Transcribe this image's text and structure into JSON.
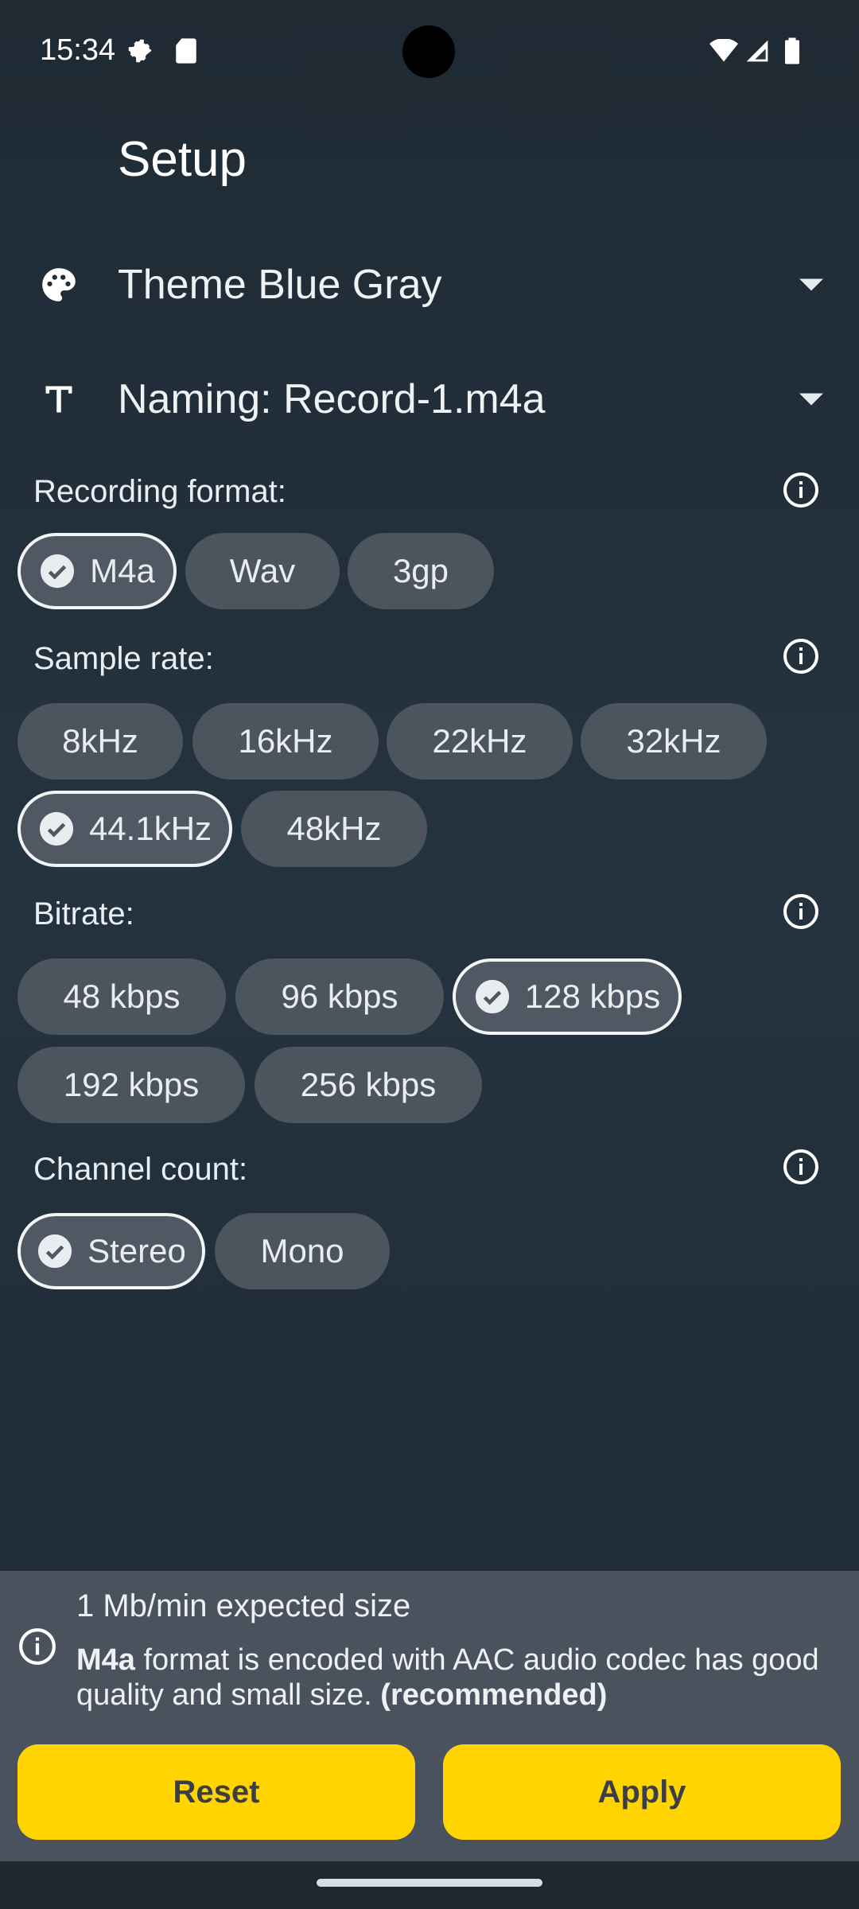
{
  "status_bar": {
    "time": "15:34",
    "icons": [
      "settings-gear-icon",
      "sd-card-icon",
      "wifi-icon",
      "signal-icon",
      "battery-icon"
    ]
  },
  "page": {
    "title": "Setup"
  },
  "theme_dropdown": {
    "label": "Theme Blue Gray",
    "icon": "palette-icon"
  },
  "naming_dropdown": {
    "label": "Naming: Record-1.m4a",
    "icon": "text-format-icon"
  },
  "recording_format": {
    "label": "Recording format:",
    "options": [
      {
        "label": "M4a",
        "selected": true
      },
      {
        "label": "Wav",
        "selected": false
      },
      {
        "label": "3gp",
        "selected": false
      }
    ]
  },
  "sample_rate": {
    "label": "Sample rate:",
    "options": [
      {
        "label": "8kHz",
        "selected": false
      },
      {
        "label": "16kHz",
        "selected": false
      },
      {
        "label": "22kHz",
        "selected": false
      },
      {
        "label": "32kHz",
        "selected": false
      },
      {
        "label": "44.1kHz",
        "selected": true
      },
      {
        "label": "48kHz",
        "selected": false
      }
    ]
  },
  "bitrate": {
    "label": "Bitrate:",
    "options": [
      {
        "label": "48 kbps",
        "selected": false
      },
      {
        "label": "96 kbps",
        "selected": false
      },
      {
        "label": "128 kbps",
        "selected": true
      },
      {
        "label": "192 kbps",
        "selected": false
      },
      {
        "label": "256 kbps",
        "selected": false
      }
    ]
  },
  "channel_count": {
    "label": "Channel count:",
    "options": [
      {
        "label": "Stereo",
        "selected": true
      },
      {
        "label": "Mono",
        "selected": false
      }
    ]
  },
  "info_panel": {
    "expected_size": "1 Mb/min expected size",
    "desc_format": "M4a",
    "desc_body": " format is encoded with AAC audio codec has good quality and small size. ",
    "desc_recommended": "(recommended)"
  },
  "buttons": {
    "reset": "Reset",
    "apply": "Apply"
  },
  "colors": {
    "accent_yellow": "#ffd400",
    "chip_bg": "#4c545e",
    "panel_bg": "#4a535d"
  }
}
